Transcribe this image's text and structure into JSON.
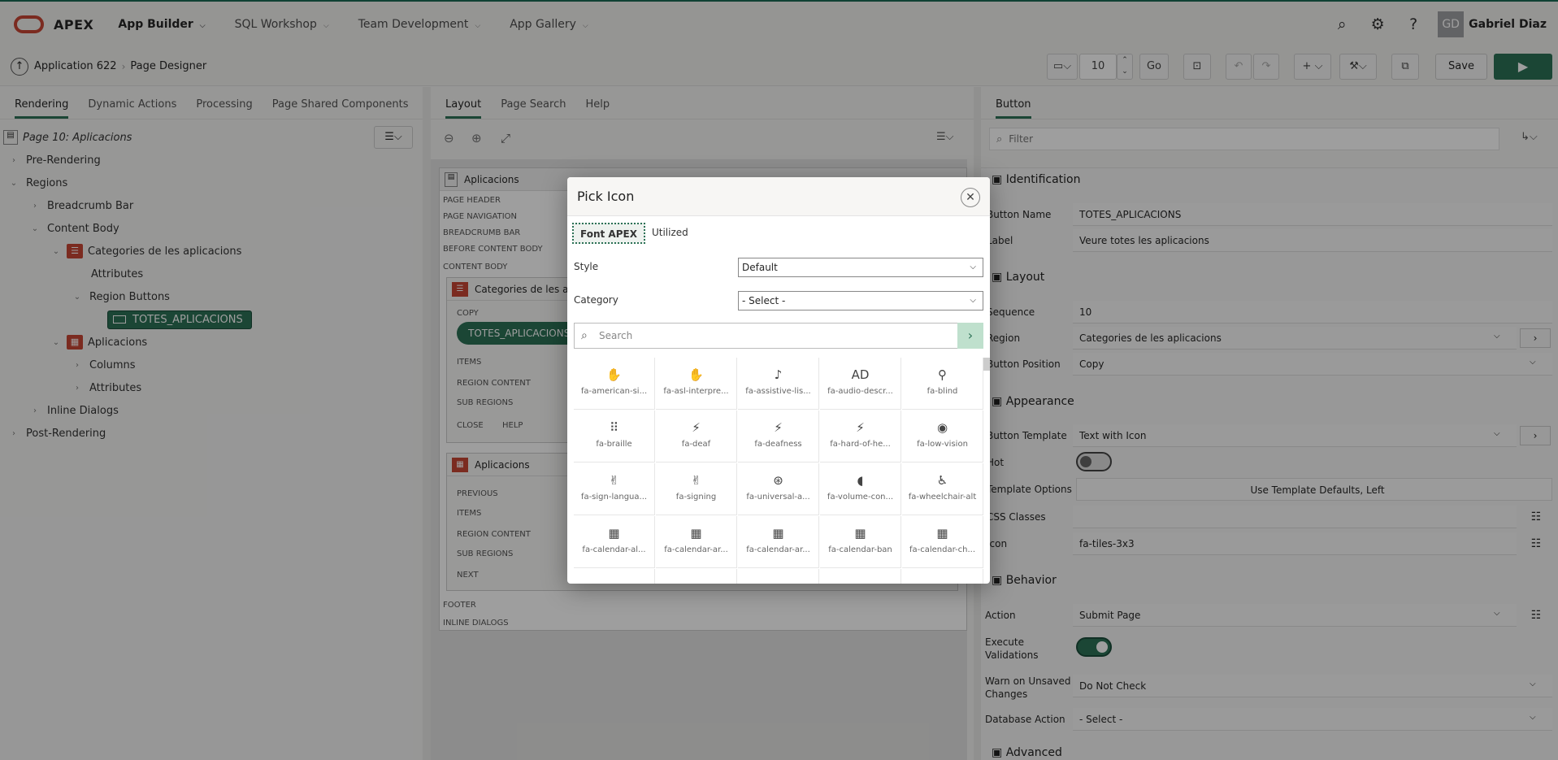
{
  "brand": {
    "name": "APEX"
  },
  "nav": {
    "items": [
      "App Builder",
      "SQL Workshop",
      "Team Development",
      "App Gallery"
    ]
  },
  "user": {
    "initials": "GD",
    "name": "Gabriel Diaz"
  },
  "breadcrumb": {
    "app": "Application 622",
    "page": "Page Designer"
  },
  "toolbar": {
    "page_number": "10",
    "go": "Go",
    "save": "Save"
  },
  "left": {
    "tabs": [
      "Rendering",
      "Dynamic Actions",
      "Processing",
      "Page Shared Components"
    ],
    "tree": {
      "page": "Page 10: Aplicacions",
      "pre": "Pre-Rendering",
      "regions": "Regions",
      "breadcrumb_bar": "Breadcrumb Bar",
      "content_body": "Content Body",
      "categories": "Categories de les aplicacions",
      "attributes": "Attributes",
      "region_buttons": "Region Buttons",
      "button": "TOTES_APLICACIONS",
      "aplicacions": "Aplicacions",
      "columns": "Columns",
      "attributes2": "Attributes",
      "inline": "Inline Dialogs",
      "post": "Post-Rendering"
    }
  },
  "middle": {
    "tabs": [
      "Layout",
      "Page Search",
      "Help"
    ],
    "page_title": "Aplicacions",
    "labels": {
      "page_header": "PAGE HEADER",
      "page_navigation": "PAGE NAVIGATION",
      "breadcrumb_bar": "BREADCRUMB BAR",
      "before_content": "BEFORE CONTENT BODY",
      "content_body": "CONTENT BODY",
      "footer": "FOOTER",
      "inline_dialogs": "INLINE DIALOGS"
    },
    "region1": {
      "title": "Categories de les aplic",
      "copy": "COPY",
      "button": "TOTES_APLICACIONS",
      "items": "ITEMS",
      "region_content": "REGION CONTENT",
      "sub_regions": "SUB REGIONS",
      "close": "CLOSE",
      "help": "HELP"
    },
    "region2": {
      "title": "Aplicacions",
      "previous": "PREVIOUS",
      "items": "ITEMS",
      "region_content": "REGION CONTENT",
      "sub_regions": "SUB REGIONS",
      "next": "NEXT"
    }
  },
  "right": {
    "tab": "Button",
    "filter_placeholder": "Filter",
    "sections": {
      "identification": "Identification",
      "layout": "Layout",
      "appearance": "Appearance",
      "behavior": "Behavior",
      "advanced": "Advanced"
    },
    "props": {
      "button_name_label": "Button Name",
      "button_name": "TOTES_APLICACIONS",
      "label_label": "Label",
      "label": "Veure totes les aplicacions",
      "sequence_label": "Sequence",
      "sequence": "10",
      "region_label": "Region",
      "region": "Categories de les aplicacions",
      "position_label": "Button Position",
      "position": "Copy",
      "template_label": "Button Template",
      "template": "Text with Icon",
      "hot_label": "Hot",
      "options_label": "Template Options",
      "options": "Use Template Defaults, Left",
      "css_label": "CSS Classes",
      "icon_label": "Icon",
      "icon": "fa-tiles-3x3",
      "action_label": "Action",
      "action": "Submit Page",
      "validations_label_1": "Execute",
      "validations_label_2": "Validations",
      "warn_label_1": "Warn on Unsaved",
      "warn_label_2": "Changes",
      "warn": "Do Not Check",
      "db_label": "Database Action",
      "db": "- Select -"
    }
  },
  "dialog": {
    "title": "Pick Icon",
    "tabs": [
      "Font APEX",
      "Utilized"
    ],
    "style_label": "Style",
    "style_value": "Default",
    "category_label": "Category",
    "category_value": "- Select -",
    "search_placeholder": "Search",
    "icons": [
      {
        "name": "fa-american-si...",
        "glyph": "✋"
      },
      {
        "name": "fa-asl-interpre...",
        "glyph": "✋"
      },
      {
        "name": "fa-assistive-lis...",
        "glyph": "♪"
      },
      {
        "name": "fa-audio-descr...",
        "glyph": "AD"
      },
      {
        "name": "fa-blind",
        "glyph": "⚲"
      },
      {
        "name": "fa-braille",
        "glyph": "⠿"
      },
      {
        "name": "fa-deaf",
        "glyph": "⚡"
      },
      {
        "name": "fa-deafness",
        "glyph": "⚡"
      },
      {
        "name": "fa-hard-of-he...",
        "glyph": "⚡"
      },
      {
        "name": "fa-low-vision",
        "glyph": "◉"
      },
      {
        "name": "fa-sign-langua...",
        "glyph": "✌"
      },
      {
        "name": "fa-signing",
        "glyph": "✌"
      },
      {
        "name": "fa-universal-a...",
        "glyph": "⊛"
      },
      {
        "name": "fa-volume-con...",
        "glyph": "◖"
      },
      {
        "name": "fa-wheelchair-alt",
        "glyph": "♿"
      },
      {
        "name": "fa-calendar-al...",
        "glyph": "▦"
      },
      {
        "name": "fa-calendar-ar...",
        "glyph": "▦"
      },
      {
        "name": "fa-calendar-ar...",
        "glyph": "▦"
      },
      {
        "name": "fa-calendar-ban",
        "glyph": "▦"
      },
      {
        "name": "fa-calendar-ch...",
        "glyph": "▦"
      }
    ]
  }
}
